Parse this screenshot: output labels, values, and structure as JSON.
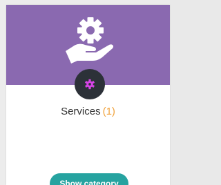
{
  "category": {
    "title": "Services",
    "count_label": "(1)",
    "button_label": "Show category",
    "hero_icon": "gear-hand-icon",
    "badge_icon": "gear-icon"
  },
  "colors": {
    "banner": "#8a69b0",
    "badge_bg": "#2c3138",
    "badge_icon": "#d644e6",
    "count": "#f0a23c",
    "button": "#26a3a0"
  }
}
